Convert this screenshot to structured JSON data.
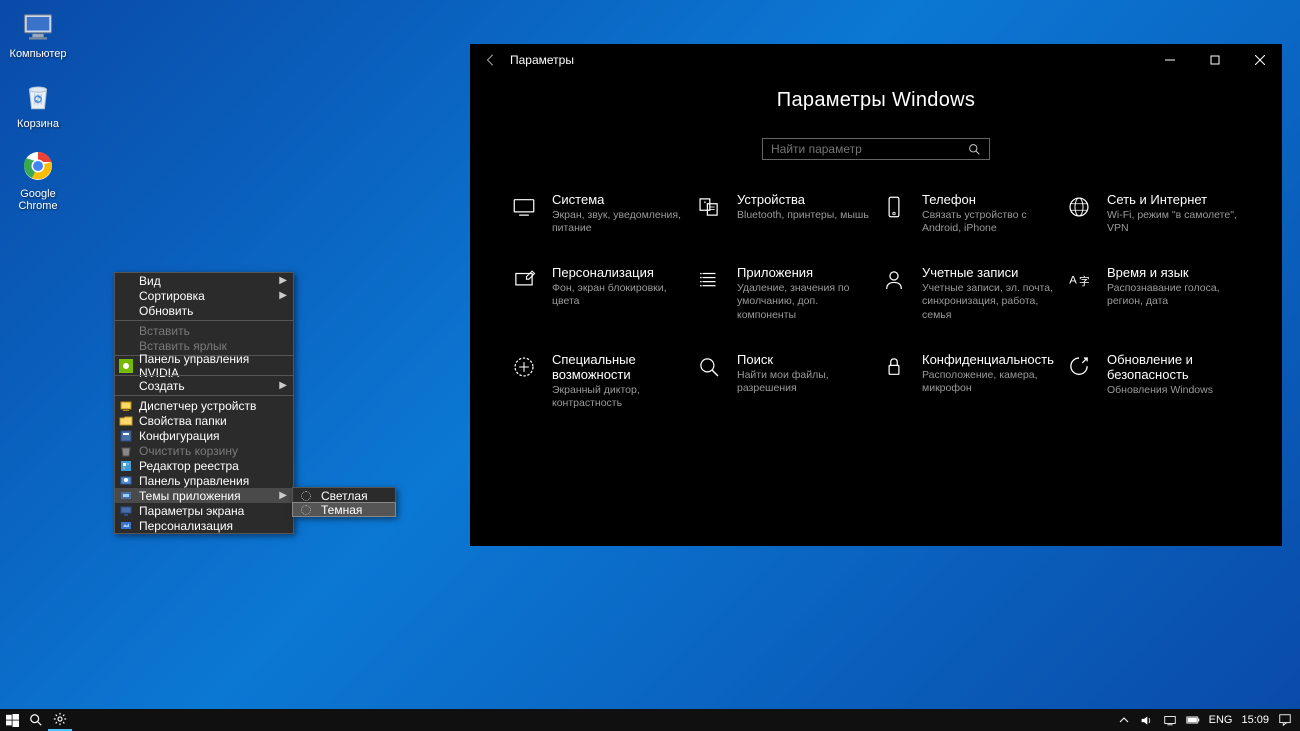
{
  "desktop": {
    "icons": [
      {
        "label": "Компьютер"
      },
      {
        "label": "Корзина"
      },
      {
        "label": "Google\nChrome"
      }
    ]
  },
  "context_menu": {
    "items": [
      {
        "label": "Вид",
        "hasSub": true
      },
      {
        "label": "Сортировка",
        "hasSub": true
      },
      {
        "label": "Обновить"
      },
      {
        "sep": true
      },
      {
        "label": "Вставить",
        "disabled": true
      },
      {
        "label": "Вставить ярлык",
        "disabled": true
      },
      {
        "sep": true
      },
      {
        "label": "Панель управления NVIDIA",
        "icon": "nvidia"
      },
      {
        "sep": true
      },
      {
        "label": "Создать",
        "hasSub": true
      },
      {
        "sep": true
      },
      {
        "label": "Диспетчер устройств",
        "icon": "dev"
      },
      {
        "label": "Свойства папки",
        "icon": "folder"
      },
      {
        "label": "Конфигурация",
        "icon": "config"
      },
      {
        "label": "Очистить корзину",
        "disabled": true,
        "icon": "bin"
      },
      {
        "label": "Редактор реестра",
        "icon": "reg"
      },
      {
        "label": "Панель управления",
        "icon": "cpl"
      },
      {
        "label": "Темы приложения",
        "hasSub": true,
        "highlight": true,
        "icon": "theme"
      },
      {
        "label": "Параметры экрана",
        "icon": "display"
      },
      {
        "label": "Персонализация",
        "icon": "perso"
      }
    ],
    "submenu": [
      {
        "label": "Светлая"
      },
      {
        "label": "Темная",
        "highlight": true
      }
    ]
  },
  "settings_window": {
    "titlebar": {
      "title": "Параметры"
    },
    "heading": "Параметры Windows",
    "search_placeholder": "Найти параметр",
    "categories": [
      {
        "title": "Система",
        "desc": "Экран, звук, уведомления, питание"
      },
      {
        "title": "Устройства",
        "desc": "Bluetooth, принтеры, мышь"
      },
      {
        "title": "Телефон",
        "desc": "Связать устройство с Android, iPhone"
      },
      {
        "title": "Сеть и Интернет",
        "desc": "Wi-Fi, режим \"в самолете\", VPN"
      },
      {
        "title": "Персонализация",
        "desc": "Фон, экран блокировки, цвета"
      },
      {
        "title": "Приложения",
        "desc": "Удаление, значения по умолчанию, доп. компоненты"
      },
      {
        "title": "Учетные записи",
        "desc": "Учетные записи, эл. почта, синхронизация, работа, семья"
      },
      {
        "title": "Время и язык",
        "desc": "Распознавание голоса, регион, дата"
      },
      {
        "title": "Специальные возможности",
        "desc": "Экранный диктор, контрастность"
      },
      {
        "title": "Поиск",
        "desc": "Найти мои файлы, разрешения"
      },
      {
        "title": "Конфиденциальность",
        "desc": "Расположение, камера, микрофон"
      },
      {
        "title": "Обновление и безопасность",
        "desc": "Обновления Windows"
      }
    ]
  },
  "taskbar": {
    "lang": "ENG",
    "time": "15:09"
  }
}
